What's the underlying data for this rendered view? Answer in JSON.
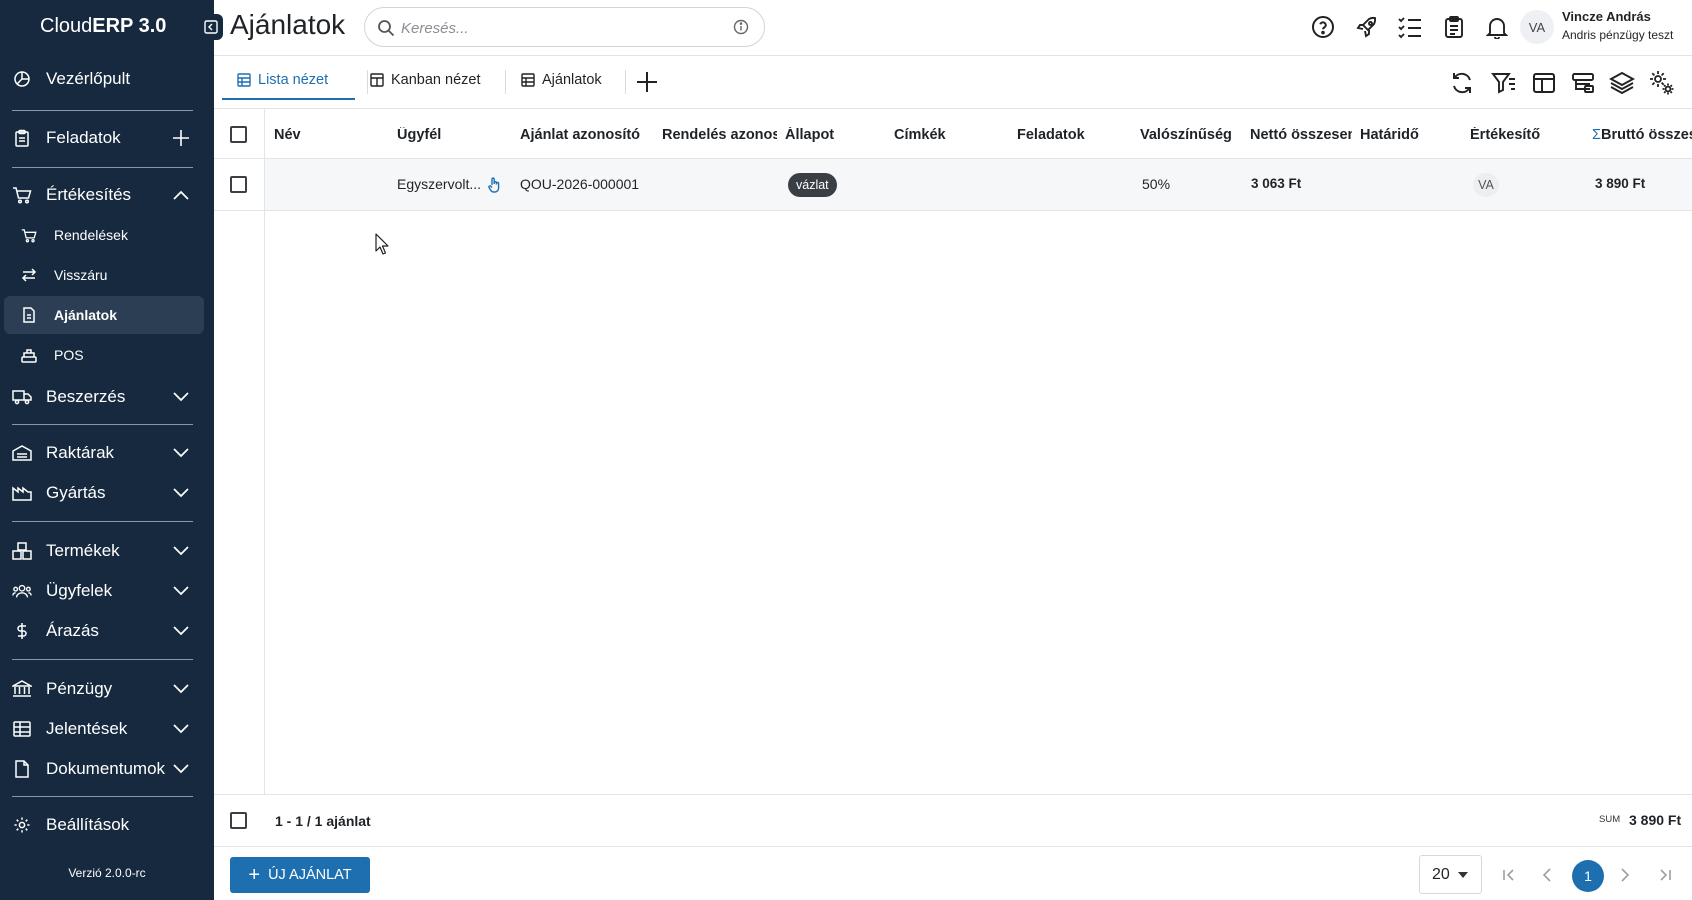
{
  "app": {
    "brand_plain": "Cloud",
    "brand_bold": "ERP 3.0",
    "version": "Verzió 2.0.0-rc"
  },
  "sidebar": {
    "dashboard": "Vezérlőpult",
    "tasks": "Feladatok",
    "sales": "Értékesítés",
    "sales_sub": [
      "Rendelések",
      "Visszáru",
      "Ajánlatok",
      "POS"
    ],
    "purchasing": "Beszerzés",
    "warehouses": "Raktárak",
    "manufacturing": "Gyártás",
    "products": "Termékek",
    "customers": "Ügyfelek",
    "pricing": "Árazás",
    "finance": "Pénzügy",
    "reports": "Jelentések",
    "documents": "Dokumentumok",
    "settings": "Beállítások",
    "active_item": "Ajánlatok"
  },
  "header": {
    "title": "Ajánlatok",
    "search_placeholder": "Keresés...",
    "user_initials": "VA",
    "user_name": "Vincze András",
    "user_org": "Andris pénzügy teszt"
  },
  "tabs": {
    "list_view": "Lista nézet",
    "kanban_view": "Kanban nézet",
    "offers": "Ajánlatok",
    "active": "Lista nézet"
  },
  "table": {
    "columns": [
      "Név",
      "Ügyfél",
      "Ajánlat azonosító",
      "Rendelés azonosító",
      "Állapot",
      "Címkék",
      "Feladatok",
      "Valószínűség",
      "Nettó összesen",
      "Határidő",
      "Értékesítő",
      "Bruttó összesen"
    ],
    "sum_symbol": "Σ",
    "rows": [
      {
        "name": "",
        "customer": "Egyszervolt...",
        "offer_id": "QOU-2026-000001",
        "order_id": "",
        "status": "vázlat",
        "tags": "",
        "tasks": "",
        "probability": "50%",
        "net_total": "3 063  Ft",
        "deadline": "",
        "salesperson": "VA",
        "gross_total": "3 890  Ft"
      }
    ]
  },
  "footer": {
    "count_text": "1 - 1 / 1 ajánlat",
    "sum_label": "SUM",
    "sum_value": "3 890  Ft",
    "new_button": "ÚJ AJÁNLAT",
    "page_size": "20",
    "current_page": "1"
  },
  "colors": {
    "sidebar_bg": "#16293e",
    "accent": "#1e6fb0",
    "status_badge": "#3a3f45"
  }
}
